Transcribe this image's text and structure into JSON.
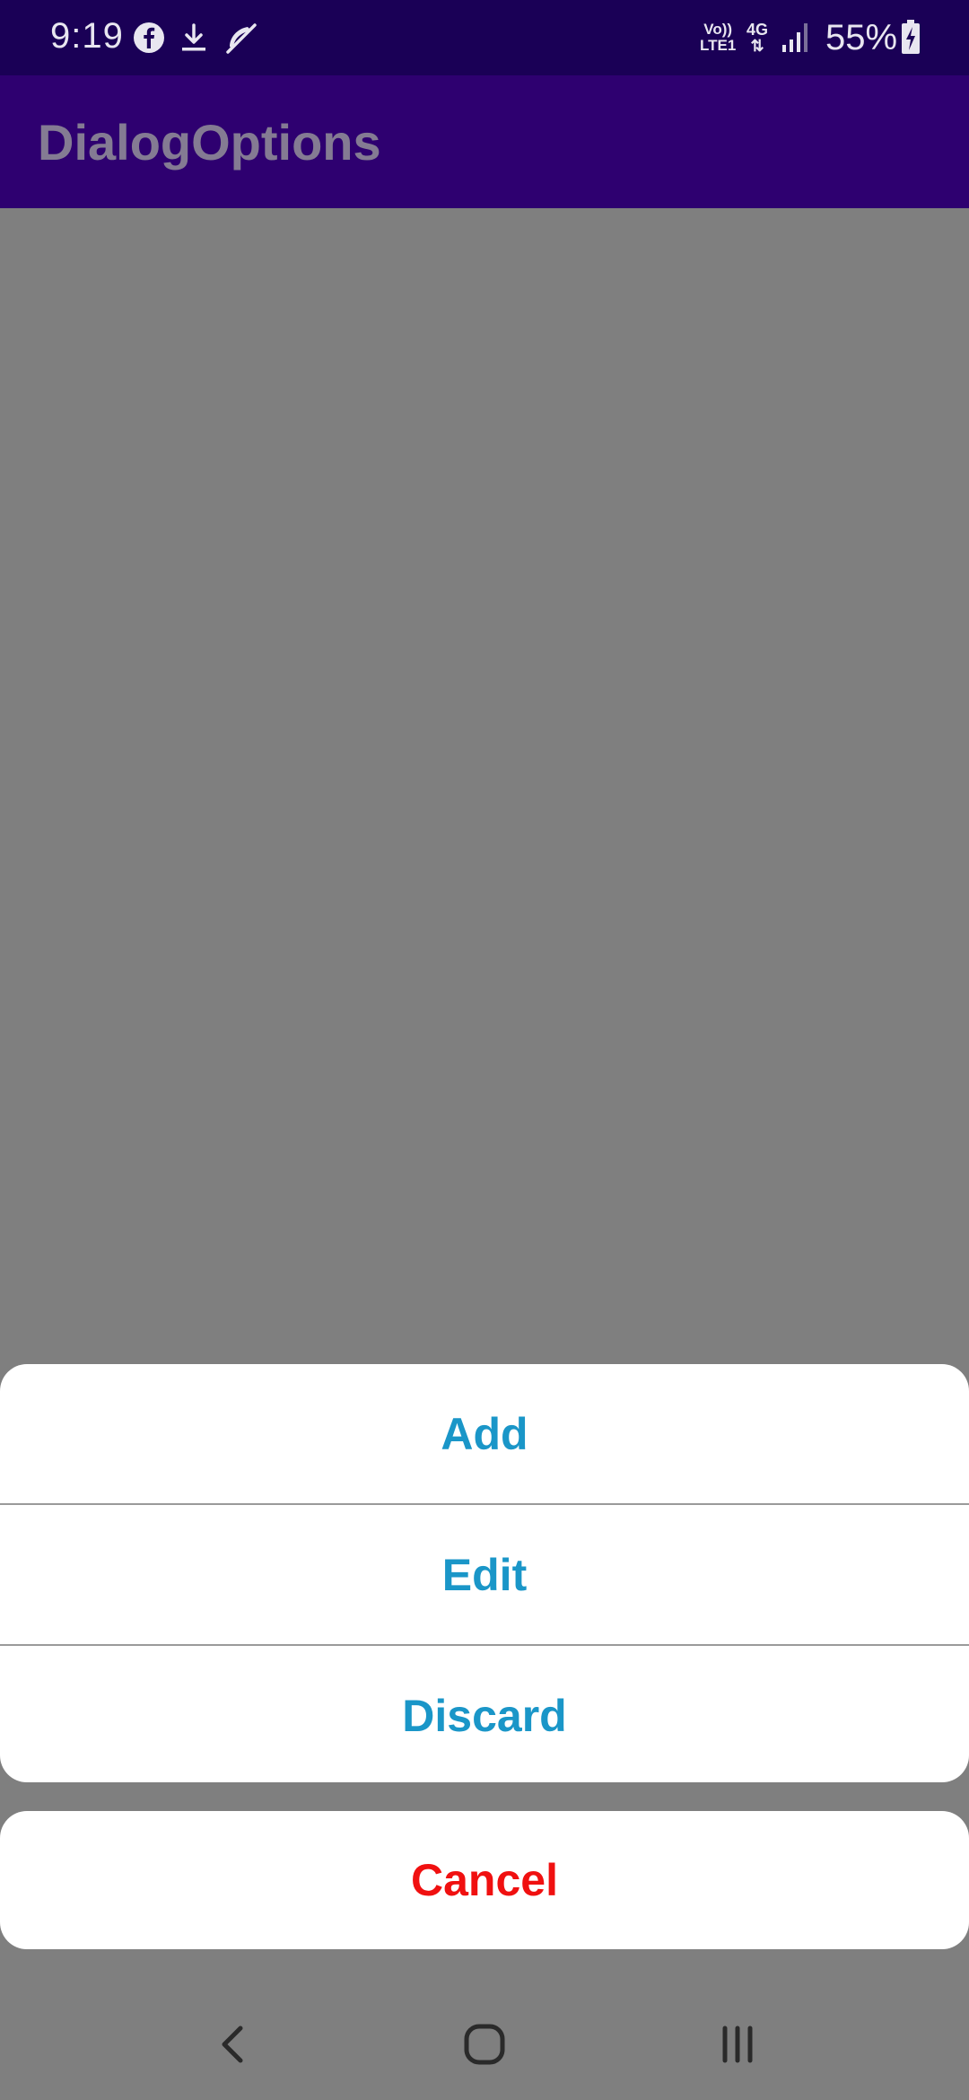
{
  "status_bar": {
    "time": "9:19",
    "volte_label_top": "Vo))",
    "volte_label_bottom": "LTE1",
    "network_label": "4G",
    "battery_percent": "55%",
    "icons": [
      "facebook-icon",
      "download-icon",
      "muted-icon",
      "signal-icon",
      "battery-charging-icon"
    ]
  },
  "app_bar": {
    "title": "DialogOptions"
  },
  "action_sheet": {
    "options": [
      {
        "label": "Add"
      },
      {
        "label": "Edit"
      },
      {
        "label": "Discard"
      }
    ],
    "cancel_label": "Cancel",
    "option_color": "#1a96c8",
    "cancel_color": "#f01010"
  },
  "nav_bar": {
    "icons": [
      "back-icon",
      "home-icon",
      "recents-icon"
    ]
  },
  "colors": {
    "status_bar": "#1a0056",
    "app_bar": "#2e0070",
    "scrim": "#7f7f7f"
  }
}
